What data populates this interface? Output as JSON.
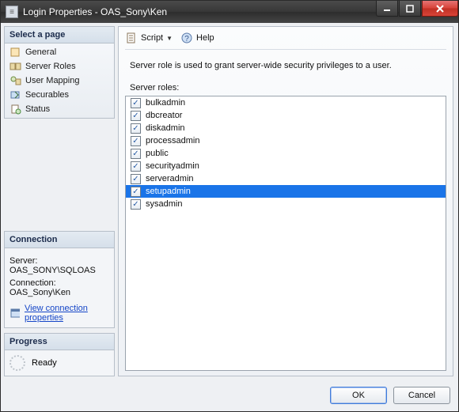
{
  "window": {
    "title": "Login Properties - OAS_Sony\\Ken"
  },
  "left": {
    "select_page_title": "Select a page",
    "pages": [
      {
        "label": "General"
      },
      {
        "label": "Server Roles"
      },
      {
        "label": "User Mapping"
      },
      {
        "label": "Securables"
      },
      {
        "label": "Status"
      }
    ],
    "connection_title": "Connection",
    "server_label": "Server:",
    "server_value": "OAS_SONY\\SQLOAS",
    "connection_label": "Connection:",
    "connection_value": "OAS_Sony\\Ken",
    "view_conn_props": "View connection properties",
    "progress_title": "Progress",
    "progress_status": "Ready"
  },
  "toolbar": {
    "script": "Script",
    "help": "Help"
  },
  "main": {
    "description": "Server role is used to grant server-wide security privileges to a user.",
    "roles_label": "Server roles:",
    "roles": [
      {
        "name": "bulkadmin",
        "checked": true
      },
      {
        "name": "dbcreator",
        "checked": true
      },
      {
        "name": "diskadmin",
        "checked": true
      },
      {
        "name": "processadmin",
        "checked": true
      },
      {
        "name": "public",
        "checked": true
      },
      {
        "name": "securityadmin",
        "checked": true
      },
      {
        "name": "serveradmin",
        "checked": true
      },
      {
        "name": "setupadmin",
        "checked": true,
        "selected": true
      },
      {
        "name": "sysadmin",
        "checked": true
      }
    ]
  },
  "buttons": {
    "ok": "OK",
    "cancel": "Cancel"
  }
}
